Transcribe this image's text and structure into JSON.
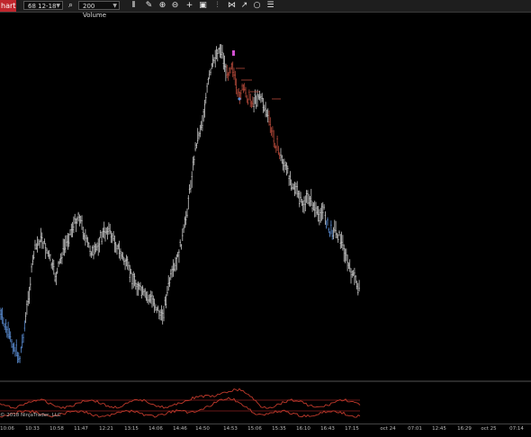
{
  "toolbar": {
    "tab_label": "hart",
    "instrument": "68 12-18",
    "interval": "200 Volume",
    "icons": [
      "search-icon",
      "bar-chart-style-icon",
      "pencil-icon",
      "zoom-in-icon",
      "zoom-out-icon",
      "crosshair-icon",
      "snapshot-icon",
      "strategy-icon",
      "performance-icon",
      "refresh-icon",
      "list-icon"
    ]
  },
  "copyright": "© 2018 NinjaTrader, LLC",
  "x_axis": {
    "labels": [
      "10:06",
      "10:33",
      "10:58",
      "11:47",
      "12:21",
      "13:15",
      "14:06",
      "14:46",
      "14:50",
      "14:53",
      "15:06",
      "15:35",
      "16:10",
      "16:43",
      "17:15",
      "oct 24",
      "07:01",
      "12:45",
      "16:29",
      "oct 25",
      "07:14"
    ]
  },
  "colors": {
    "bars": "#c8c8c8",
    "down_highlight": "#b5493a",
    "blue_highlight": "#5c8fd6",
    "magenta_marker": "#d050d0",
    "indicator_line": "#c0392b",
    "indicator_level": "#8a2020"
  },
  "chart_data": {
    "type": "candlestick",
    "x": [
      "10:06",
      "10:33",
      "10:58",
      "11:47",
      "12:21",
      "13:15",
      "14:06",
      "14:46",
      "14:50",
      "14:53",
      "15:06",
      "15:35",
      "16:10",
      "16:43",
      "17:15"
    ],
    "ohlc_series_description": "",
    "grid": false
  }
}
